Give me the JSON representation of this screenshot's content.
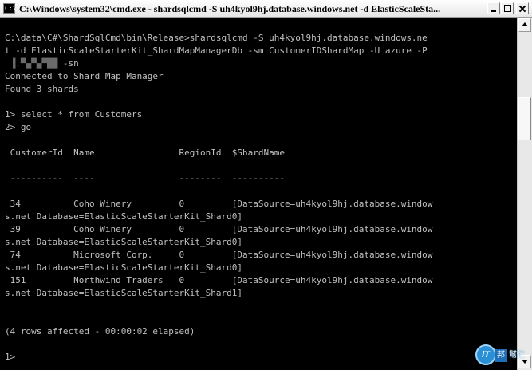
{
  "window": {
    "title": "C:\\Windows\\system32\\cmd.exe - shardsqlcmd  -S uh4kyol9hj.database.windows.net -d ElasticScaleSta...",
    "icon": "C:\\",
    "icon_name": "cmd-icon",
    "controls": {
      "minimize": "minimize-icon",
      "maximize": "maximize-icon",
      "close": "close-icon"
    }
  },
  "console": {
    "colors": {
      "background": "#000000",
      "foreground": "#c0c0c0"
    },
    "command_line_1": "C:\\data\\C#\\ShardSqlCmd\\bin\\Release>shardsqlcmd -S uh4kyol9hj.database.windows.ne",
    "command_line_2": "t -d ElasticScaleStarterKit_ShardMapManagerDb -sm CustomerIDShardMap -U azure -P",
    "command_line_3_redacted": " ▐.▀▄▀▄▀██",
    "command_line_3_rest": "-sn",
    "connected_message": "Connected to Shard Map Manager",
    "shards_found": "Found 3 shards",
    "prompt_1": "1> select * from Customers",
    "prompt_2": "2> go",
    "table": {
      "header": " CustomerId  Name                RegionId  $ShardName",
      "separator": " ----------  ----                --------  ----------",
      "rows": [
        {
          "line1": " 34          Coho Winery         0         [DataSource=uh4kyol9hj.database.window",
          "line2": "s.net Database=ElasticScaleStarterKit_Shard0]"
        },
        {
          "line1": " 39          Coho Winery         0         [DataSource=uh4kyol9hj.database.window",
          "line2": "s.net Database=ElasticScaleStarterKit_Shard0]"
        },
        {
          "line1": " 74          Microsoft Corp.     0         [DataSource=uh4kyol9hj.database.window",
          "line2": "s.net Database=ElasticScaleStarterKit_Shard0]"
        },
        {
          "line1": " 151         Northwind Traders   0         [DataSource=uh4kyol9hj.database.window",
          "line2": "s.net Database=ElasticScaleStarterKit_Shard1]"
        }
      ]
    },
    "rows_affected": "(4 rows affected - 00:00:02 elapsed)",
    "final_prompt": "1>"
  },
  "scrollbar": {
    "up_icon": "arrow-up-icon",
    "down_icon": "arrow-down-icon"
  },
  "watermark": {
    "logo_text": "iT",
    "box_char": "邦",
    "text": "幫忙"
  }
}
